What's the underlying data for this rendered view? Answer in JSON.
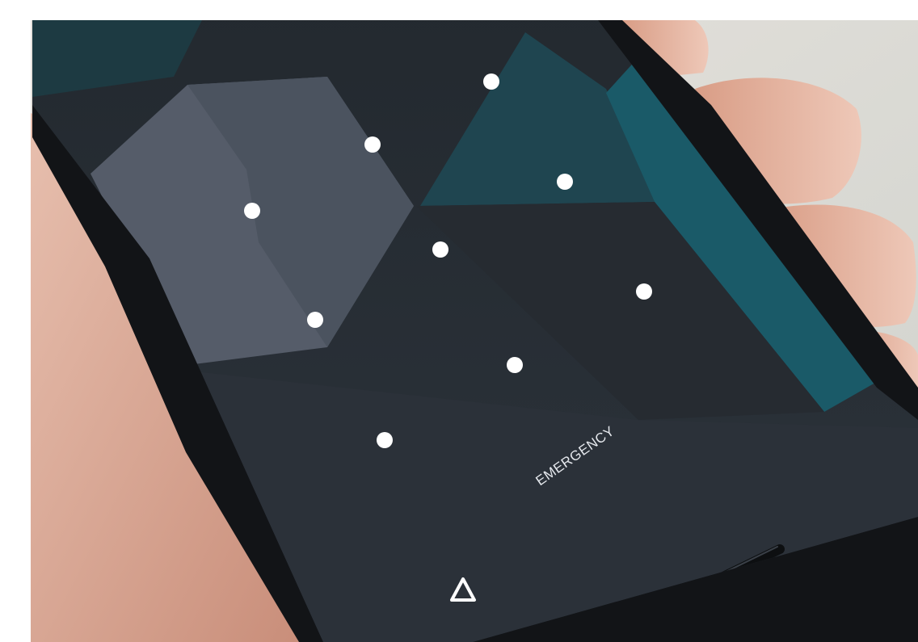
{
  "lock_screen": {
    "emergency_label": "EMERGENCY",
    "pattern_dots": 9,
    "home_icon": "triangle-outline-icon"
  },
  "colors": {
    "screen_base": "#262b31",
    "hexagon_face": "#555c69",
    "teal_panel": "#1f4550",
    "skin": "#dcae9b",
    "dot": "#ffffff"
  }
}
